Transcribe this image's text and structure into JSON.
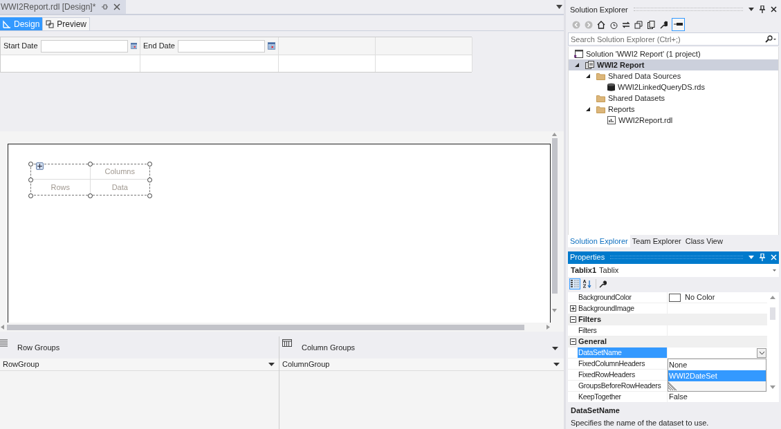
{
  "document_tab": {
    "title": "WWI2Report.rdl [Design]*",
    "selected": true
  },
  "view_tabs": [
    {
      "label": "Design",
      "selected": true
    },
    {
      "label": "Preview",
      "selected": false
    }
  ],
  "parameters": [
    {
      "label": "Start Date"
    },
    {
      "label": "End Date"
    }
  ],
  "tablix": {
    "column_header": "Columns",
    "row_header": "Rows",
    "data": "Data"
  },
  "grouping": [
    {
      "kind": "rows",
      "title": "Row Groups",
      "group": "RowGroup"
    },
    {
      "kind": "columns",
      "title": "Column Groups",
      "group": "ColumnGroup"
    }
  ],
  "solution_explorer": {
    "title": "Solution Explorer",
    "search": {
      "placeholder": "Search Solution Explorer (Ctrl+;)"
    },
    "tree": [
      {
        "label": "Solution 'WWI2 Report' (1 project)",
        "kind": "solution",
        "selected": false,
        "children": [
          {
            "label": "WWI2 Report",
            "kind": "project",
            "selected": true,
            "expanded": true,
            "children": [
              {
                "label": "Shared Data Sources",
                "kind": "folder",
                "selected": false,
                "expanded": true,
                "children": [
                  {
                    "label": "WWI2LinkedQueryDS.rds",
                    "kind": "datasource",
                    "selected": false
                  }
                ]
              },
              {
                "label": "Shared Datasets",
                "kind": "folder",
                "selected": false
              },
              {
                "label": "Reports",
                "kind": "folder",
                "selected": false,
                "expanded": true,
                "children": [
                  {
                    "label": "WWI2Report.rdl",
                    "kind": "report",
                    "selected": false
                  }
                ]
              }
            ]
          }
        ]
      }
    ]
  },
  "bottom_tabs": [
    {
      "label": "Solution Explorer",
      "selected": true
    },
    {
      "label": "Team Explorer",
      "selected": false
    },
    {
      "label": "Class View",
      "selected": false
    }
  ],
  "properties": {
    "title": "Properties",
    "object": {
      "name": "Tablix1",
      "type": "Tablix"
    },
    "sort_modes": [
      {
        "kind": "categorized",
        "selected": true
      },
      {
        "kind": "alphabetical",
        "selected": false
      }
    ],
    "rows": [
      {
        "kind": "color",
        "name": "BackgroundColor",
        "value": "No Color",
        "selected": false
      },
      {
        "kind": "property",
        "name": "BackgroundImage",
        "expanded": false,
        "selected": false
      },
      {
        "kind": "category",
        "name": "Filters",
        "expanded": true
      },
      {
        "kind": "property",
        "name": "Filters",
        "selected": false
      },
      {
        "kind": "category",
        "name": "General",
        "expanded": true
      },
      {
        "kind": "property",
        "name": "DataSetName",
        "selected": true,
        "dropdown": true
      },
      {
        "kind": "property",
        "name": "FixedColumnHeaders",
        "selected": false
      },
      {
        "kind": "property",
        "name": "FixedRowHeaders",
        "selected": false
      },
      {
        "kind": "property",
        "name": "GroupsBeforeRowHeaders",
        "selected": false
      },
      {
        "kind": "property",
        "name": "KeepTogether",
        "value": "False",
        "selected": false
      }
    ],
    "dropdown_options": [
      {
        "label": "None",
        "selected": false
      },
      {
        "label": "WWI2DateSet",
        "selected": true
      }
    ],
    "description": {
      "title": "DataSetName",
      "text": "Specifies the name of the dataset to use."
    }
  }
}
